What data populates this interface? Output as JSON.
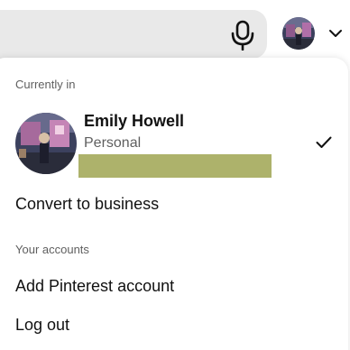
{
  "header": {
    "mic_icon": "microphone-icon",
    "chevron_icon": "chevron-down-icon"
  },
  "menu": {
    "currently_in_label": "Currently in",
    "account": {
      "name": "Emily Howell",
      "type": "Personal",
      "check_icon": "checkmark-icon",
      "redaction_color": "#adb26b"
    },
    "convert_label": "Convert to business",
    "your_accounts_label": "Your accounts",
    "add_account_label": "Add Pinterest account",
    "logout_label": "Log out"
  },
  "colors": {
    "search_bg": "#e9e9e9",
    "text_primary": "#111111",
    "text_secondary": "#5f5f5f"
  }
}
